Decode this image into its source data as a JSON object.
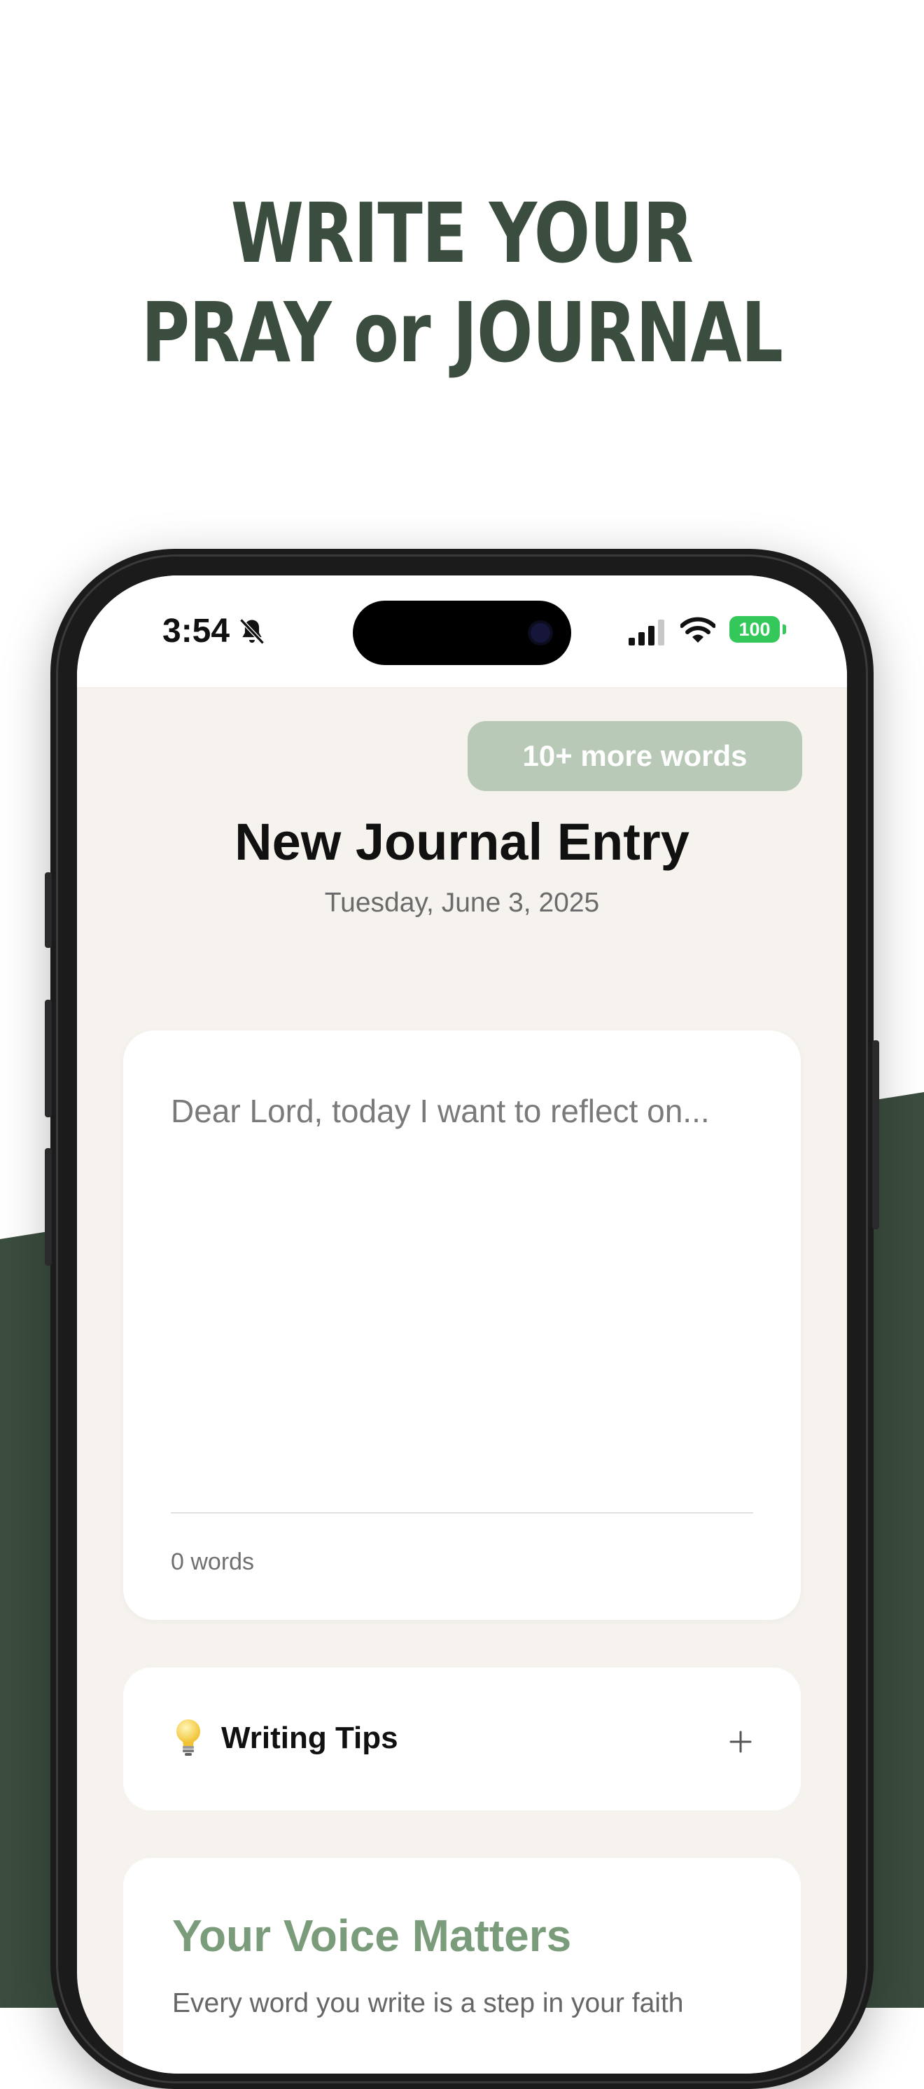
{
  "colors": {
    "brand_dark_green": "#3b4d3f",
    "muted_green": "#b9c9b7",
    "accent_green": "#7b9c7b",
    "app_background": "#f6f3ee",
    "battery_green": "#34c759"
  },
  "headline": {
    "line1": "WRITE YOUR",
    "line2": "PRAY or JOURNAL"
  },
  "status_bar": {
    "time": "3:54",
    "battery_level": "100",
    "icons": [
      "bell-slash-icon",
      "cellular-signal-icon",
      "wifi-icon",
      "battery-icon"
    ]
  },
  "header": {
    "more_words_button": "10+ more words",
    "title": "New Journal Entry",
    "date": "Tuesday, June 3, 2025"
  },
  "editor": {
    "placeholder": "Dear Lord, today I want to reflect on...",
    "word_count": "0 words"
  },
  "tips": {
    "icon": "lightbulb-icon",
    "label": "Writing Tips",
    "toggle_icon": "plus-icon"
  },
  "voice_card": {
    "title": "Your Voice Matters",
    "text": "Every word you write is a step in your faith"
  }
}
